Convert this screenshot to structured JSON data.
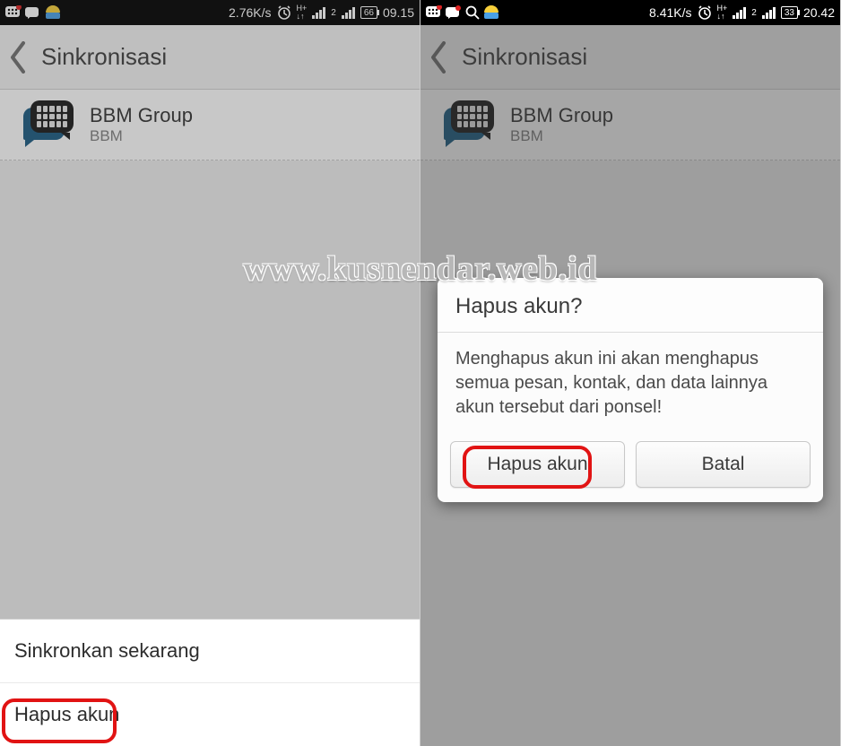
{
  "watermark": "www.kusnendar.web.id",
  "left": {
    "status": {
      "speed": "2.76K/s",
      "battery": "66",
      "time": "09.15"
    },
    "header_title": "Sinkronisasi",
    "account": {
      "title": "BBM Group",
      "subtitle": "BBM"
    },
    "menu": {
      "item1": "Sinkronkan sekarang",
      "item2": "Hapus akun"
    }
  },
  "right": {
    "status": {
      "speed": "8.41K/s",
      "battery": "33",
      "time": "20.42"
    },
    "header_title": "Sinkronisasi",
    "account": {
      "title": "BBM Group",
      "subtitle": "BBM"
    },
    "dialog": {
      "title": "Hapus akun?",
      "body": "Menghapus akun ini akan menghapus semua pesan, kontak, dan data lainnya akun tersebut dari ponsel!",
      "confirm": "Hapus akun",
      "cancel": "Batal"
    }
  }
}
